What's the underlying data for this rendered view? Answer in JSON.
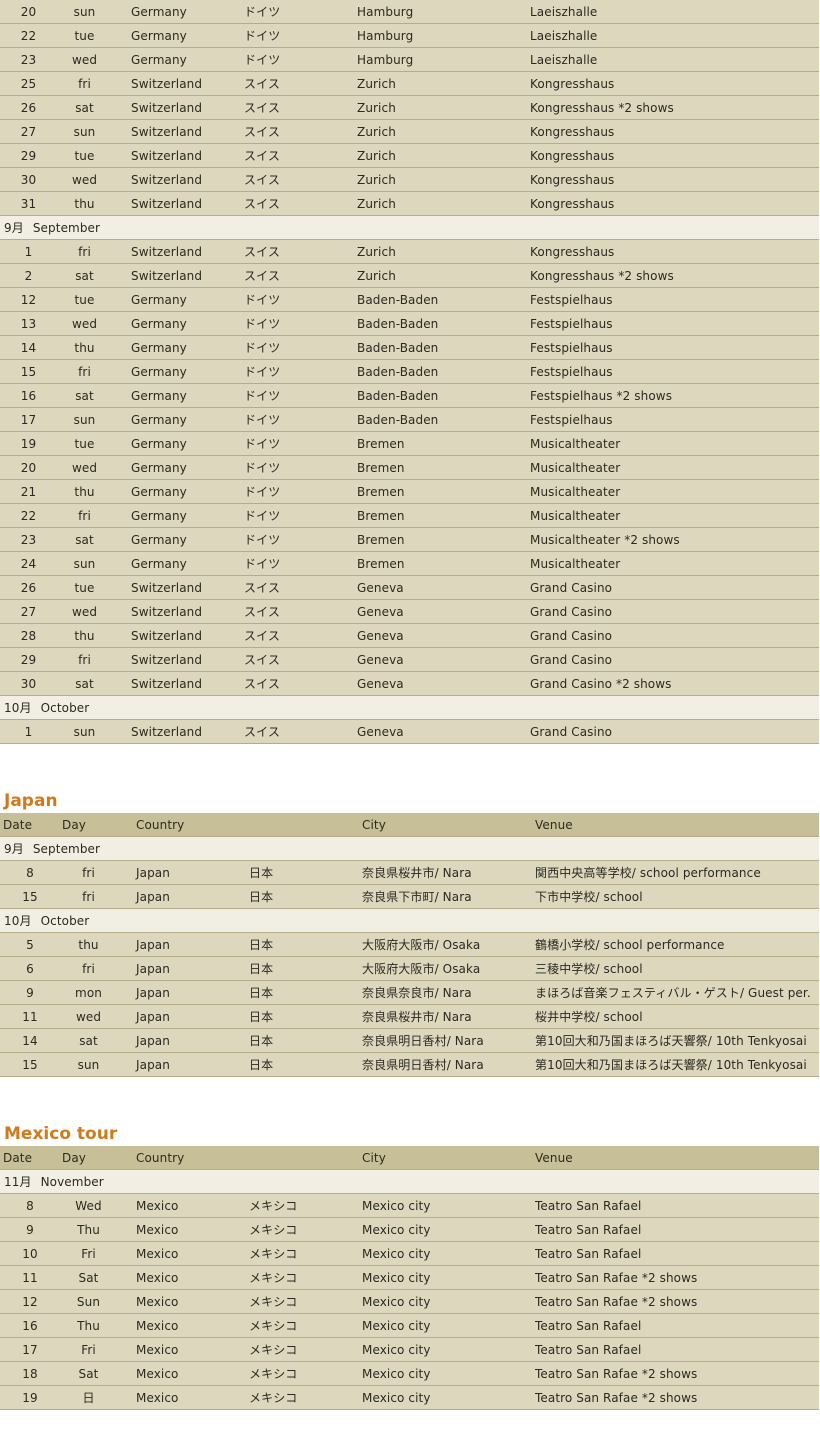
{
  "europe": {
    "groups": [
      {
        "month": null,
        "rows": [
          [
            "20",
            "sun",
            "Germany",
            "ドイツ",
            "Hamburg",
            "Laeiszhalle"
          ],
          [
            "22",
            "tue",
            "Germany",
            "ドイツ",
            "Hamburg",
            "Laeiszhalle"
          ],
          [
            "23",
            "wed",
            "Germany",
            "ドイツ",
            "Hamburg",
            "Laeiszhalle"
          ],
          [
            "25",
            "fri",
            "Switzerland",
            "スイス",
            "Zurich",
            "Kongresshaus"
          ],
          [
            "26",
            "sat",
            "Switzerland",
            "スイス",
            "Zurich",
            "Kongresshaus  *2 shows"
          ],
          [
            "27",
            "sun",
            "Switzerland",
            "スイス",
            "Zurich",
            "Kongresshaus"
          ],
          [
            "29",
            "tue",
            "Switzerland",
            "スイス",
            "Zurich",
            "Kongresshaus"
          ],
          [
            "30",
            "wed",
            "Switzerland",
            "スイス",
            "Zurich",
            "Kongresshaus"
          ],
          [
            "31",
            "thu",
            "Switzerland",
            "スイス",
            "Zurich",
            "Kongresshaus"
          ]
        ]
      },
      {
        "month": [
          "9月",
          "September"
        ],
        "rows": [
          [
            "1",
            "fri",
            "Switzerland",
            "スイス",
            "Zurich",
            "Kongresshaus"
          ],
          [
            "2",
            "sat",
            "Switzerland",
            "スイス",
            "Zurich",
            "Kongresshaus  *2 shows"
          ],
          [
            "12",
            "tue",
            "Germany",
            "ドイツ",
            "Baden-Baden",
            "Festspielhaus"
          ],
          [
            "13",
            "wed",
            "Germany",
            "ドイツ",
            "Baden-Baden",
            "Festspielhaus"
          ],
          [
            "14",
            "thu",
            "Germany",
            "ドイツ",
            "Baden-Baden",
            "Festspielhaus"
          ],
          [
            "15",
            "fri",
            "Germany",
            "ドイツ",
            "Baden-Baden",
            "Festspielhaus"
          ],
          [
            "16",
            "sat",
            "Germany",
            "ドイツ",
            "Baden-Baden",
            "Festspielhaus  *2 shows"
          ],
          [
            "17",
            "sun",
            "Germany",
            "ドイツ",
            "Baden-Baden",
            "Festspielhaus"
          ],
          [
            "19",
            "tue",
            "Germany",
            "ドイツ",
            "Bremen",
            "Musicaltheater"
          ],
          [
            "20",
            "wed",
            "Germany",
            "ドイツ",
            "Bremen",
            "Musicaltheater"
          ],
          [
            "21",
            "thu",
            "Germany",
            "ドイツ",
            "Bremen",
            "Musicaltheater"
          ],
          [
            "22",
            "fri",
            "Germany",
            "ドイツ",
            "Bremen",
            "Musicaltheater"
          ],
          [
            "23",
            "sat",
            "Germany",
            "ドイツ",
            "Bremen",
            "Musicaltheater  *2 shows"
          ],
          [
            "24",
            "sun",
            "Germany",
            "ドイツ",
            "Bremen",
            "Musicaltheater"
          ],
          [
            "26",
            "tue",
            "Switzerland",
            "スイス",
            "Geneva",
            "Grand Casino"
          ],
          [
            "27",
            "wed",
            "Switzerland",
            "スイス",
            "Geneva",
            "Grand Casino"
          ],
          [
            "28",
            "thu",
            "Switzerland",
            "スイス",
            "Geneva",
            "Grand Casino"
          ],
          [
            "29",
            "fri",
            "Switzerland",
            "スイス",
            "Geneva",
            "Grand Casino"
          ],
          [
            "30",
            "sat",
            "Switzerland",
            "スイス",
            "Geneva",
            "Grand Casino  *2 shows"
          ]
        ]
      },
      {
        "month": [
          "10月",
          "October"
        ],
        "rows": [
          [
            "1",
            "sun",
            "Switzerland",
            "スイス",
            "Geneva",
            "Grand Casino"
          ]
        ]
      }
    ]
  },
  "japan": {
    "title": "Japan",
    "headers": [
      "Date",
      "Day",
      "Country",
      "City",
      "Venue"
    ],
    "groups": [
      {
        "month": [
          "9月",
          "September"
        ],
        "rows": [
          [
            "8",
            "fri",
            "Japan",
            "日本",
            "奈良県桜井市/ Nara",
            "関西中央高等学校/ school performance"
          ],
          [
            "15",
            "fri",
            "Japan",
            "日本",
            "奈良県下市町/ Nara",
            "下市中学校/ school"
          ]
        ]
      },
      {
        "month": [
          "10月",
          "October"
        ],
        "rows": [
          [
            "5",
            "thu",
            "Japan",
            "日本",
            "大阪府大阪市/ Osaka",
            "鶴橋小学校/ school performance"
          ],
          [
            "6",
            "fri",
            "Japan",
            "日本",
            "大阪府大阪市/ Osaka",
            "三稜中学校/ school"
          ],
          [
            "9",
            "mon",
            "Japan",
            "日本",
            "奈良県奈良市/ Nara",
            "まほろば音楽フェスティバル・ゲスト/ Guest per."
          ],
          [
            "11",
            "wed",
            "Japan",
            "日本",
            "奈良県桜井市/ Nara",
            "桜井中学校/ school"
          ],
          [
            "14",
            "sat",
            "Japan",
            "日本",
            "奈良県明日香村/ Nara",
            "第10回大和乃国まほろば天響祭/ 10th Tenkyosai"
          ],
          [
            "15",
            "sun",
            "Japan",
            "日本",
            "奈良県明日香村/ Nara",
            "第10回大和乃国まほろば天響祭/ 10th Tenkyosai"
          ]
        ]
      }
    ]
  },
  "mexico": {
    "title": "Mexico tour",
    "headers": [
      "Date",
      "Day",
      "Country",
      "City",
      "Venue"
    ],
    "groups": [
      {
        "month": [
          "11月",
          "November"
        ],
        "rows": [
          [
            "8",
            "Wed",
            "Mexico",
            "メキシコ",
            "Mexico city",
            "Teatro San Rafael"
          ],
          [
            "9",
            "Thu",
            "Mexico",
            "メキシコ",
            "Mexico city",
            "Teatro San Rafael"
          ],
          [
            "10",
            "Fri",
            "Mexico",
            "メキシコ",
            "Mexico city",
            "Teatro San Rafael"
          ],
          [
            "11",
            "Sat",
            "Mexico",
            "メキシコ",
            "Mexico city",
            "Teatro San Rafae  *2 shows"
          ],
          [
            "12",
            "Sun",
            "Mexico",
            "メキシコ",
            "Mexico city",
            "Teatro San Rafae  *2 shows"
          ],
          [
            "16",
            "Thu",
            "Mexico",
            "メキシコ",
            "Mexico city",
            "Teatro San Rafael"
          ],
          [
            "17",
            "Fri",
            "Mexico",
            "メキシコ",
            "Mexico city",
            "Teatro San Rafael"
          ],
          [
            "18",
            "Sat",
            "Mexico",
            "メキシコ",
            "Mexico city",
            "Teatro San Rafae  *2 shows"
          ],
          [
            "19",
            "日",
            "Mexico",
            "メキシコ",
            "Mexico city",
            "Teatro San Rafae  *2 shows"
          ]
        ]
      }
    ]
  }
}
